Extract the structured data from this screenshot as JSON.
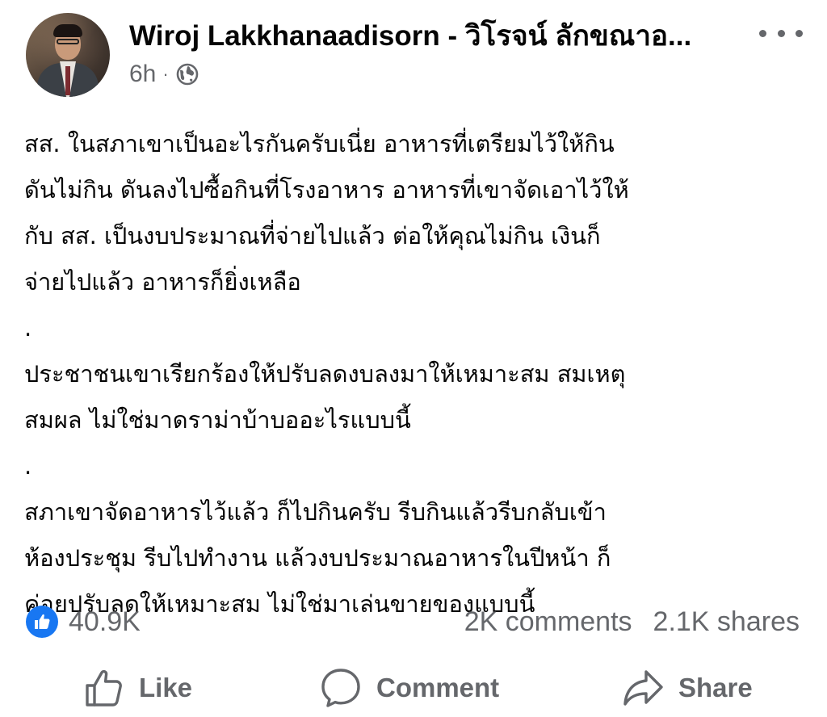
{
  "post": {
    "author": "Wiroj Lakkhanaadisorn - วิโรจน์ ลักขณาอ...",
    "time": "6h",
    "separator": "·",
    "privacy_icon": "globe-icon",
    "more_icon": "more-options-icon",
    "body": [
      "สส. ในสภาเขาเป็นอะไรกันครับเนี่ย อาหารที่เตรียมไว้ให้กิน",
      "ดันไม่กิน ดันลงไปซื้อกินที่โรงอาหาร อาหารที่เขาจัดเอาไว้ให้",
      "กับ สส. เป็นงบประมาณที่จ่ายไปแล้ว ต่อให้คุณไม่กิน เงินก็",
      "จ่ายไปแล้ว อาหารก็ยิ่งเหลือ",
      ".",
      "ประชาชนเขาเรียกร้องให้ปรับลดงบลงมาให้เหมาะสม สมเหตุ",
      "สมผล ไม่ใช่มาดราม่าบ้าบออะไรแบบนี้",
      ".",
      "สภาเขาจัดอาหารไว้แล้ว ก็ไปกินครับ รีบกินแล้วรีบกลับเข้า",
      "ห้องประชุม รีบไปทำงาน แล้วงบประมาณอาหารในปีหน้า ก็",
      "ค่อยปรับลดให้เหมาะสม ไม่ใช่มาเล่นขายของแบบนี้"
    ]
  },
  "stats": {
    "reactions": "40.9K",
    "comments": "2K comments",
    "shares": "2.1K shares"
  },
  "actions": {
    "like": "Like",
    "comment": "Comment",
    "share": "Share"
  },
  "colors": {
    "accent": "#1877f2",
    "secondary_text": "#65676b",
    "primary_text": "#050505"
  }
}
